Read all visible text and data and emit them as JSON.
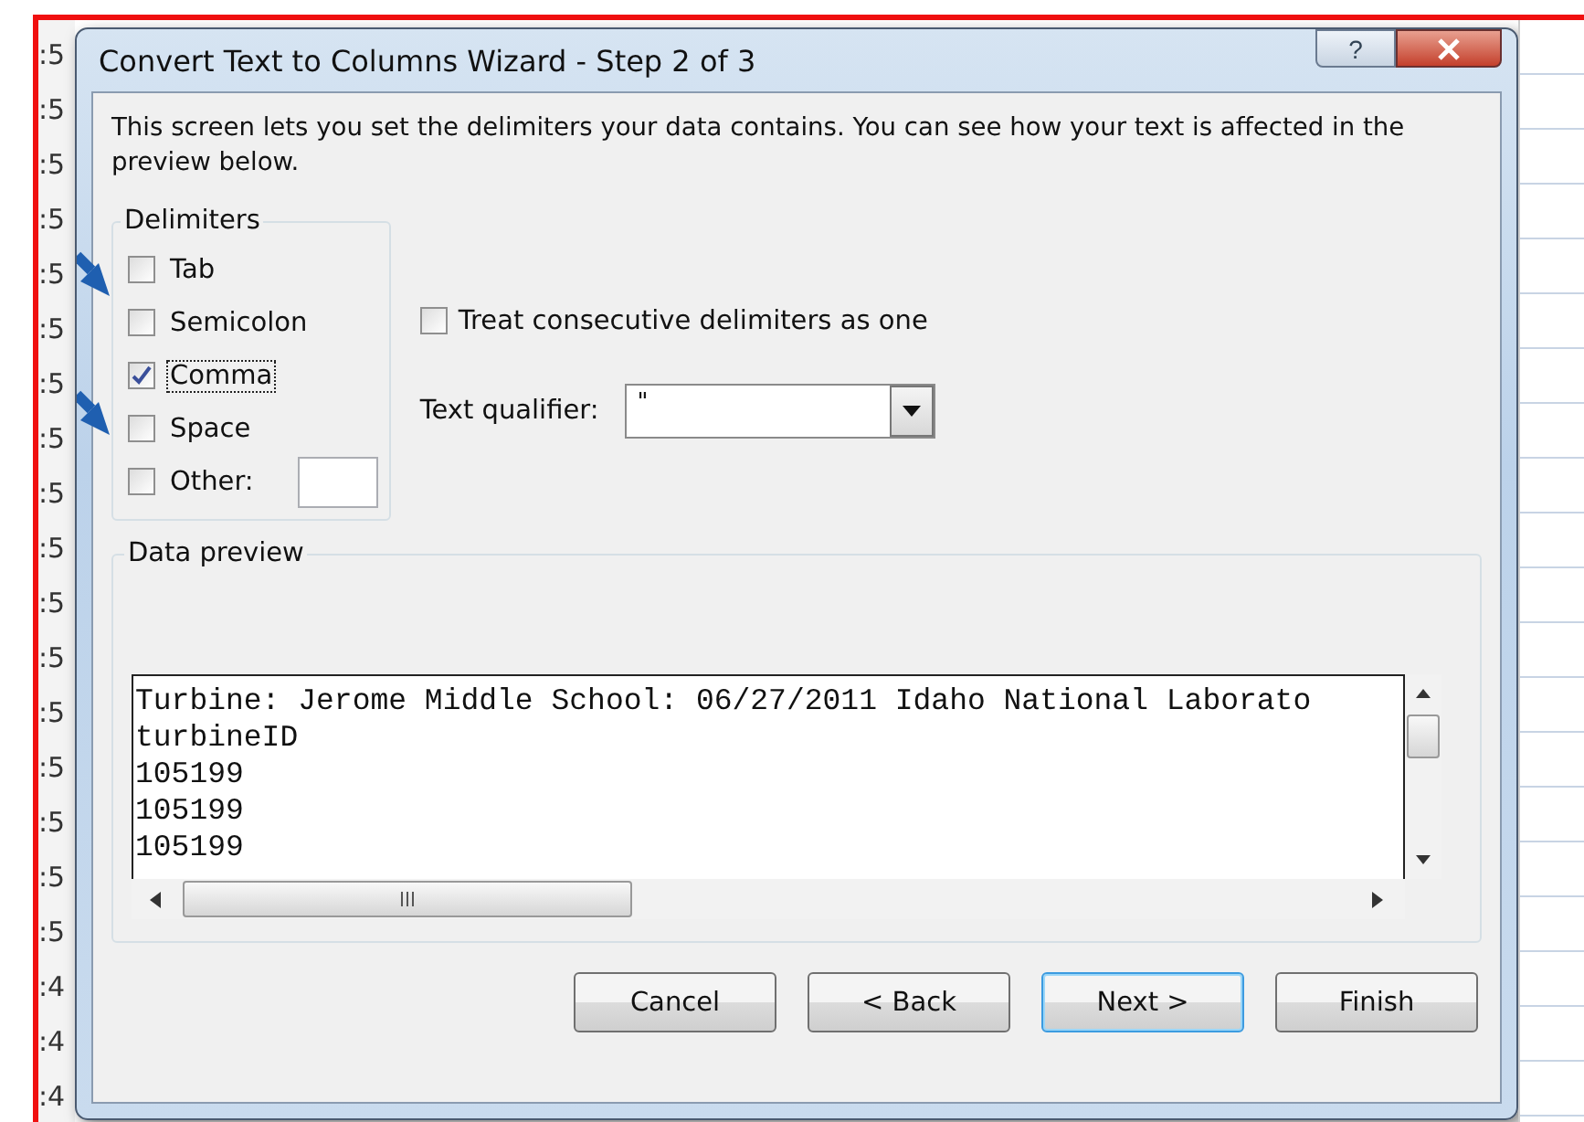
{
  "background_sheet": {
    "cells": [
      ":5",
      ":5",
      ":5",
      ":5",
      ":5",
      ":5",
      ":5",
      ":5",
      ":5",
      ":5",
      ":5",
      ":5",
      ":5",
      ":5",
      ":5",
      ":5",
      ":5",
      ":4",
      ":4",
      ":4"
    ]
  },
  "dialog": {
    "title": "Convert Text to Columns Wizard - Step 2 of 3",
    "title_buttons": [
      {
        "kind": "help",
        "label": "?"
      },
      {
        "kind": "close"
      }
    ],
    "description": "This screen lets you set the delimiters your data contains.  You can see how your text is affected in the preview below.",
    "delimiters": {
      "legend": "Delimiters",
      "options": [
        {
          "kind": "checkbox",
          "label": "Tab",
          "checked": false,
          "focused": false
        },
        {
          "kind": "checkbox",
          "label": "Semicolon",
          "checked": false,
          "focused": false
        },
        {
          "kind": "checkbox",
          "label": "Comma",
          "checked": true,
          "focused": true
        },
        {
          "kind": "checkbox",
          "label": "Space",
          "checked": false,
          "focused": false
        },
        {
          "kind": "other",
          "label": "Other:",
          "checked": false,
          "focused": false
        }
      ]
    },
    "treat_consecutive": {
      "label": "Treat consecutive delimiters as one",
      "checked": false
    },
    "text_qualifier": {
      "label": "Text qualifier:",
      "value": "\""
    },
    "data_preview": {
      "legend": "Data preview",
      "lines": [
        "Turbine: Jerome Middle School: 06/27/2011 Idaho National Laborato",
        "turbineID",
        "105199",
        "105199",
        "105199"
      ]
    },
    "buttons": [
      {
        "label": "Cancel",
        "default": false
      },
      {
        "label": "< Back",
        "default": false
      },
      {
        "label": "Next >",
        "default": true
      },
      {
        "label": "Finish",
        "default": false
      }
    ]
  }
}
